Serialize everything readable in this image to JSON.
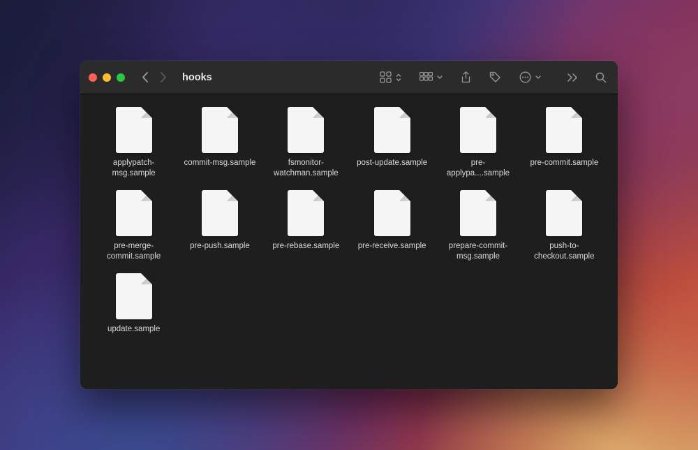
{
  "window": {
    "title": "hooks"
  },
  "files": [
    {
      "label": "applypatch-msg.sample"
    },
    {
      "label": "commit-msg.sample"
    },
    {
      "label": "fsmonitor-watchman.sample"
    },
    {
      "label": "post-update.sample"
    },
    {
      "label": "pre-applypa....sample"
    },
    {
      "label": "pre-commit.sample"
    },
    {
      "label": "pre-merge-commit.sample"
    },
    {
      "label": "pre-push.sample"
    },
    {
      "label": "pre-rebase.sample"
    },
    {
      "label": "pre-receive.sample"
    },
    {
      "label": "prepare-commit-msg.sample"
    },
    {
      "label": "push-to-checkout.sample"
    },
    {
      "label": "update.sample"
    }
  ]
}
